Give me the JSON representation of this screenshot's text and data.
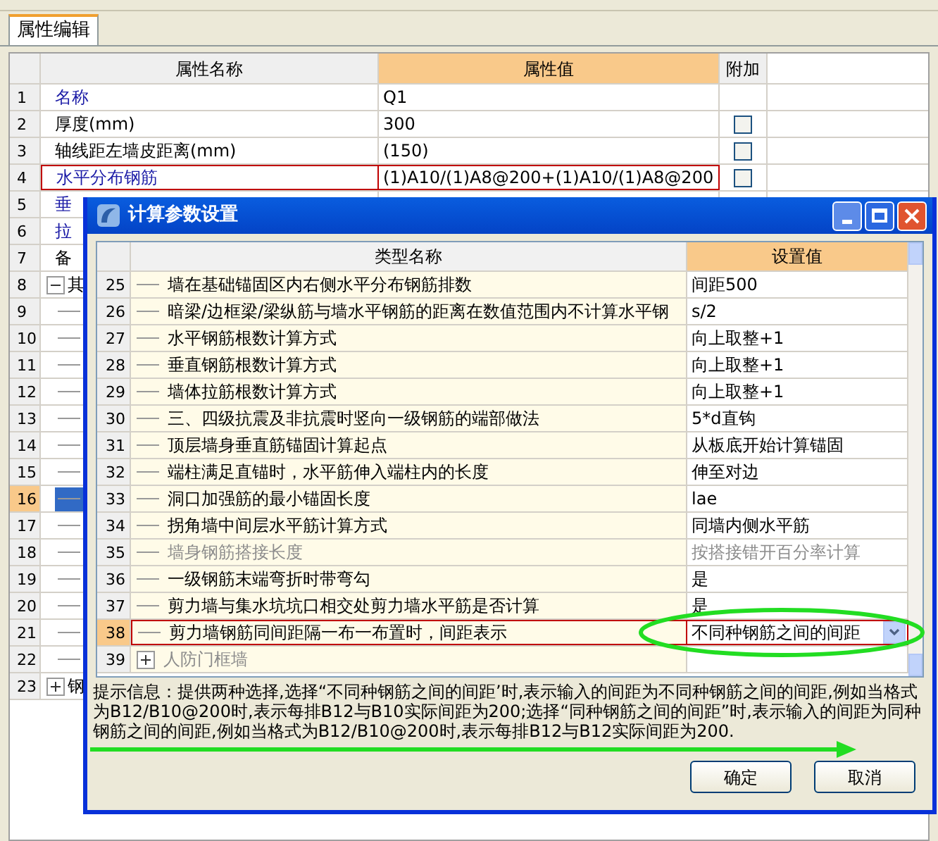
{
  "tabs": [
    {
      "label": "属性编辑",
      "selected": true
    }
  ],
  "property_grid": {
    "columns": [
      {
        "label": "属性名称",
        "selected": false
      },
      {
        "label": "属性值",
        "selected": true
      },
      {
        "label": "附加",
        "selected": false
      }
    ],
    "rows": [
      {
        "num": "1",
        "name": "名称",
        "value": "Q1",
        "kind": "link",
        "selected": false,
        "outlined": false
      },
      {
        "num": "2",
        "name": "厚度(mm)",
        "value": "300",
        "kind": "item",
        "selected": false,
        "outlined": false,
        "extra": {
          "checked": false
        }
      },
      {
        "num": "3",
        "name": "轴线距左墙皮距离(mm)",
        "value": "(150)",
        "kind": "item",
        "selected": false,
        "outlined": false,
        "extra": {
          "checked": false
        }
      },
      {
        "num": "4",
        "name": "水平分布钢筋",
        "value": "(1)A10/(1)A8@200+(1)A10/(1)A8@200",
        "kind": "link",
        "selected": false,
        "outlined": true,
        "extra": {
          "checked": false
        }
      },
      {
        "num": "5",
        "name": "垂",
        "kind": "link",
        "selected": false,
        "outlined": false
      },
      {
        "num": "6",
        "name": "拉",
        "kind": "link",
        "selected": false,
        "outlined": false
      },
      {
        "num": "7",
        "name": "备",
        "kind": "item",
        "selected": false,
        "outlined": false
      },
      {
        "num": "8",
        "name": "其",
        "kind": "group",
        "expanded": true,
        "selected": false,
        "outlined": false
      },
      {
        "num": "9",
        "kind": "child",
        "selected": false,
        "outlined": false
      },
      {
        "num": "10",
        "kind": "child",
        "selected": false,
        "outlined": false
      },
      {
        "num": "11",
        "kind": "child",
        "selected": false,
        "outlined": false
      },
      {
        "num": "12",
        "kind": "child",
        "selected": false,
        "outlined": false
      },
      {
        "num": "13",
        "kind": "child",
        "selected": false,
        "outlined": false
      },
      {
        "num": "14",
        "kind": "child",
        "selected": false,
        "outlined": false
      },
      {
        "num": "15",
        "kind": "child",
        "selected": false,
        "outlined": false
      },
      {
        "num": "16",
        "kind": "child",
        "selected": true,
        "outlined": false
      },
      {
        "num": "17",
        "kind": "child",
        "selected": false,
        "outlined": false
      },
      {
        "num": "18",
        "kind": "child",
        "selected": false,
        "outlined": false
      },
      {
        "num": "19",
        "kind": "child",
        "selected": false,
        "outlined": false
      },
      {
        "num": "20",
        "kind": "child",
        "selected": false,
        "outlined": false
      },
      {
        "num": "21",
        "kind": "child",
        "selected": false,
        "outlined": false
      },
      {
        "num": "22",
        "kind": "child",
        "selected": false,
        "outlined": false
      },
      {
        "num": "23",
        "name": "钢",
        "kind": "group",
        "expanded": false,
        "selected": false,
        "outlined": false
      }
    ]
  },
  "dialog": {
    "title": "计算参数设置",
    "columns": [
      {
        "label": "类型名称",
        "selected": false
      },
      {
        "label": "设置值",
        "selected": true
      }
    ],
    "rows": [
      {
        "num": "25",
        "name": "墙在基础锚固区内右侧水平分布钢筋排数",
        "value": "间距500",
        "kind": "item",
        "disabled": false,
        "selected": false
      },
      {
        "num": "26",
        "name": "暗梁/边框梁/梁纵筋与墙水平钢筋的距离在数值范围内不计算水平钢",
        "value": "s/2",
        "kind": "item",
        "disabled": false,
        "selected": false
      },
      {
        "num": "27",
        "name": "水平钢筋根数计算方式",
        "value": "向上取整+1",
        "kind": "item",
        "disabled": false,
        "selected": false
      },
      {
        "num": "28",
        "name": "垂直钢筋根数计算方式",
        "value": "向上取整+1",
        "kind": "item",
        "disabled": false,
        "selected": false
      },
      {
        "num": "29",
        "name": "墙体拉筋根数计算方式",
        "value": "向上取整+1",
        "kind": "item",
        "disabled": false,
        "selected": false
      },
      {
        "num": "30",
        "name": "三、四级抗震及非抗震时竖向一级钢筋的端部做法",
        "value": "5*d直钩",
        "kind": "item",
        "disabled": false,
        "selected": false
      },
      {
        "num": "31",
        "name": "顶层墙身垂直筋锚固计算起点",
        "value": "从板底开始计算锚固",
        "kind": "item",
        "disabled": false,
        "selected": false
      },
      {
        "num": "32",
        "name": "端柱满足直锚时，水平筋伸入端柱内的长度",
        "value": "伸至对边",
        "kind": "item",
        "disabled": false,
        "selected": false
      },
      {
        "num": "33",
        "name": "洞口加强筋的最小锚固长度",
        "value": "lae",
        "kind": "item",
        "disabled": false,
        "selected": false
      },
      {
        "num": "34",
        "name": "拐角墙中间层水平筋计算方式",
        "value": "同墙内侧水平筋",
        "kind": "item",
        "disabled": false,
        "selected": false
      },
      {
        "num": "35",
        "name": "墙身钢筋搭接长度",
        "value": "按搭接错开百分率计算",
        "kind": "item",
        "disabled": true,
        "selected": false
      },
      {
        "num": "36",
        "name": "一级钢筋末端弯折时带弯勾",
        "value": "是",
        "kind": "item",
        "disabled": false,
        "selected": false
      },
      {
        "num": "37",
        "name": "剪力墙与集水坑坑口相交处剪力墙水平筋是否计算",
        "value": "是",
        "kind": "item",
        "disabled": false,
        "selected": false
      },
      {
        "num": "38",
        "name": "剪力墙钢筋同间距隔一布一布置时，间距表示",
        "value": "不同种钢筋之间的间距",
        "kind": "dropdown",
        "disabled": false,
        "selected": true
      },
      {
        "num": "39",
        "name": "人防门框墙",
        "kind": "group",
        "expanded": false,
        "disabled": true,
        "selected": false
      }
    ],
    "hint": "提示信息：提供两种选择,选择“不同种钢筋之间的间距’时,表示输入的间距为不同种钢筋之间的间距,例如当格式为B12/B10@200时,表示每排B12与B10实际间距为200;选择“同种钢筋之间的间距”时,表示输入的间距为同种钢筋之间的间距,例如当格式为B12/B10@200时,表示每排B12与B12实际间距为200.",
    "buttons": [
      "确定",
      "取消"
    ]
  }
}
